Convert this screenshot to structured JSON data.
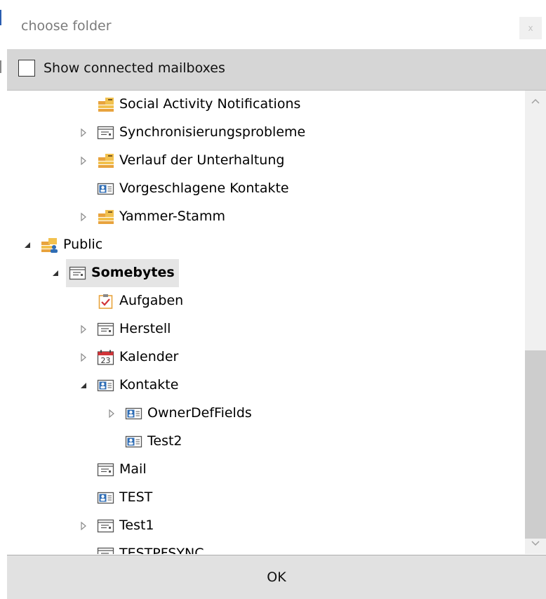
{
  "dialog": {
    "title": "choose folder",
    "close_label": "x"
  },
  "options": {
    "show_connected_label": "Show connected mailboxes",
    "show_connected_checked": false
  },
  "tree": {
    "items": [
      {
        "label": "Social Activity Notifications",
        "icon": "folder-stack-icon",
        "level": 2,
        "expander": "none"
      },
      {
        "label": "Synchronisierungsprobleme",
        "icon": "mail-folder-icon",
        "level": 2,
        "expander": "collapsed"
      },
      {
        "label": "Verlauf der Unterhaltung",
        "icon": "folder-stack-icon",
        "level": 2,
        "expander": "collapsed"
      },
      {
        "label": "Vorgeschlagene Kontakte",
        "icon": "contacts-icon",
        "level": 2,
        "expander": "none"
      },
      {
        "label": "Yammer-Stamm",
        "icon": "folder-stack-icon",
        "level": 2,
        "expander": "collapsed"
      },
      {
        "label": "Public",
        "icon": "public-folder-icon",
        "level": 0,
        "expander": "expanded"
      },
      {
        "label": "Somebytes",
        "icon": "mail-folder-icon",
        "level": 1,
        "expander": "expanded",
        "selected": true,
        "bold": true
      },
      {
        "label": "Aufgaben",
        "icon": "tasks-icon",
        "level": 2,
        "expander": "none"
      },
      {
        "label": "Herstell",
        "icon": "mail-folder-icon",
        "level": 2,
        "expander": "collapsed"
      },
      {
        "label": "Kalender",
        "icon": "calendar-icon",
        "level": 2,
        "expander": "collapsed"
      },
      {
        "label": "Kontakte",
        "icon": "contacts-icon",
        "level": 2,
        "expander": "expanded"
      },
      {
        "label": "OwnerDefFields",
        "icon": "contacts-icon",
        "level": 3,
        "expander": "collapsed"
      },
      {
        "label": "Test2",
        "icon": "contacts-icon",
        "level": 3,
        "expander": "none"
      },
      {
        "label": "Mail",
        "icon": "mail-folder-icon",
        "level": 2,
        "expander": "none"
      },
      {
        "label": "TEST",
        "icon": "contacts-icon",
        "level": 2,
        "expander": "none"
      },
      {
        "label": "Test1",
        "icon": "mail-folder-icon",
        "level": 2,
        "expander": "collapsed"
      },
      {
        "label": "TESTPFSYNC",
        "icon": "mail-folder-icon",
        "level": 2,
        "expander": "none"
      }
    ],
    "calendar_day": "23"
  },
  "footer": {
    "ok_label": "OK"
  },
  "colors": {
    "selection": "#e5e5e5",
    "option_bar": "#d6d6d6",
    "folder_yellow": "#f2c14e",
    "folder_orange": "#e8a33d",
    "contacts_blue": "#2f6db5",
    "calendar_red": "#d13438"
  }
}
